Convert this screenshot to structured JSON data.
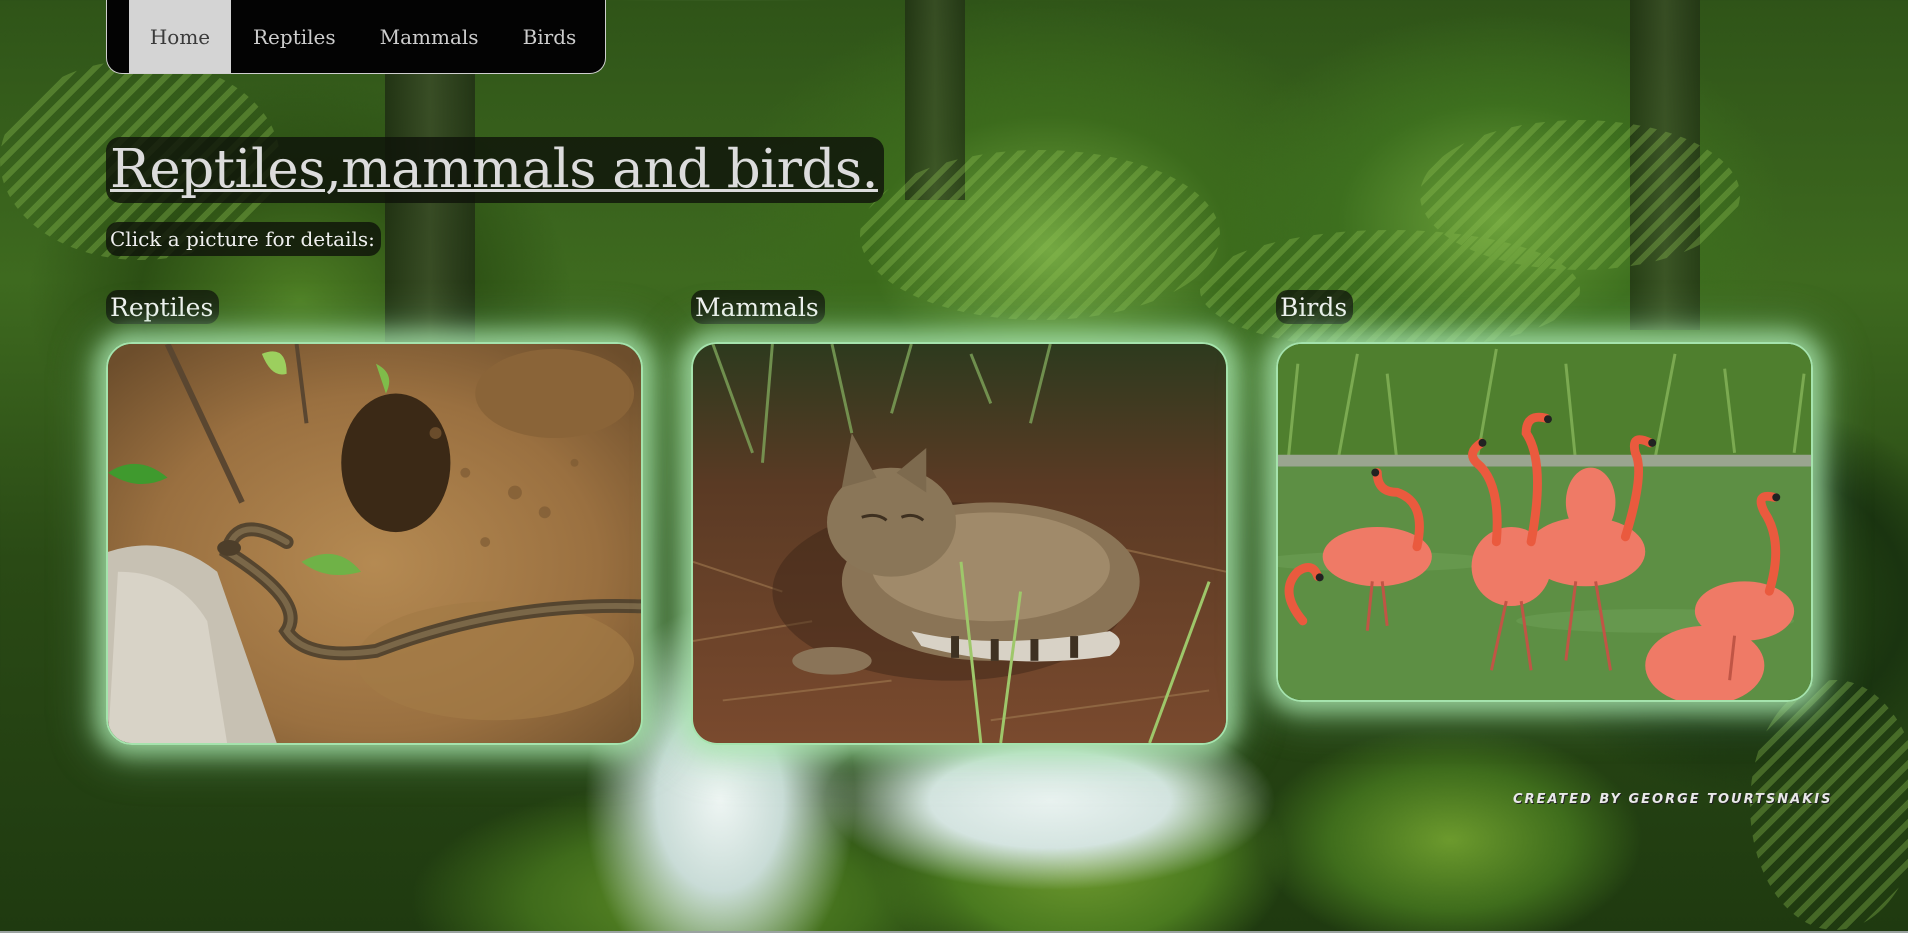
{
  "nav": {
    "items": [
      {
        "label": "Home",
        "active": true
      },
      {
        "label": "Reptiles",
        "active": false
      },
      {
        "label": "Mammals",
        "active": false
      },
      {
        "label": "Birds",
        "active": false
      }
    ]
  },
  "header": {
    "title": "Reptiles,mammals and birds.",
    "hint": "Click a picture for details:"
  },
  "gallery": [
    {
      "label": "Reptiles",
      "image": "snake-on-mud-photo"
    },
    {
      "label": "Mammals",
      "image": "wild-cat-resting-photo"
    },
    {
      "label": "Birds",
      "image": "flamingos-in-water-photo"
    }
  ],
  "footer": {
    "credit": "CREATED BY GEORGE TOURTSNAKIS"
  },
  "colors": {
    "nav_bg": "#030303",
    "nav_active": "#d4d4d4",
    "card_glow": "#a5e3ad"
  }
}
